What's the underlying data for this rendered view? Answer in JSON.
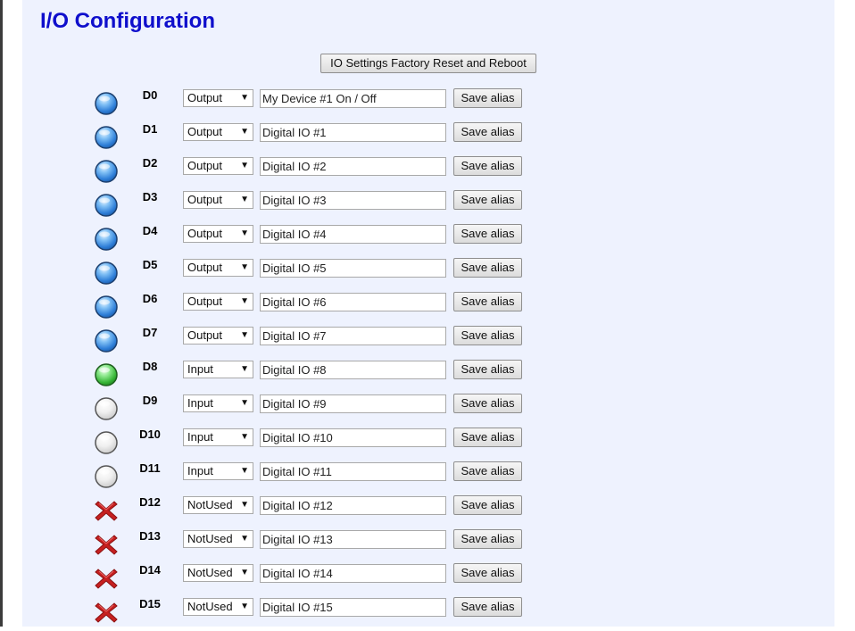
{
  "page": {
    "title": "I/O Configuration"
  },
  "toolbar": {
    "reset_label": "IO Settings Factory Reset and Reboot"
  },
  "colors": {
    "title": "#0f0fcc",
    "panel_bg": "#eef2fe"
  },
  "rows": [
    {
      "pin": "D0",
      "mode": "Output",
      "alias": "My Device #1 On / Off",
      "status_icon": "led-blue-icon",
      "save_label": "Save alias"
    },
    {
      "pin": "D1",
      "mode": "Output",
      "alias": "Digital IO #1",
      "status_icon": "led-blue-icon",
      "save_label": "Save alias"
    },
    {
      "pin": "D2",
      "mode": "Output",
      "alias": "Digital IO #2",
      "status_icon": "led-blue-icon",
      "save_label": "Save alias"
    },
    {
      "pin": "D3",
      "mode": "Output",
      "alias": "Digital IO #3",
      "status_icon": "led-blue-icon",
      "save_label": "Save alias"
    },
    {
      "pin": "D4",
      "mode": "Output",
      "alias": "Digital IO #4",
      "status_icon": "led-blue-icon",
      "save_label": "Save alias"
    },
    {
      "pin": "D5",
      "mode": "Output",
      "alias": "Digital IO #5",
      "status_icon": "led-blue-icon",
      "save_label": "Save alias"
    },
    {
      "pin": "D6",
      "mode": "Output",
      "alias": "Digital IO #6",
      "status_icon": "led-blue-icon",
      "save_label": "Save alias"
    },
    {
      "pin": "D7",
      "mode": "Output",
      "alias": "Digital IO #7",
      "status_icon": "led-blue-icon",
      "save_label": "Save alias"
    },
    {
      "pin": "D8",
      "mode": "Input",
      "alias": "Digital IO #8",
      "status_icon": "led-green-icon",
      "save_label": "Save alias"
    },
    {
      "pin": "D9",
      "mode": "Input",
      "alias": "Digital IO #9",
      "status_icon": "led-off-icon",
      "save_label": "Save alias"
    },
    {
      "pin": "D10",
      "mode": "Input",
      "alias": "Digital IO #10",
      "status_icon": "led-off-icon",
      "save_label": "Save alias"
    },
    {
      "pin": "D11",
      "mode": "Input",
      "alias": "Digital IO #11",
      "status_icon": "led-off-icon",
      "save_label": "Save alias"
    },
    {
      "pin": "D12",
      "mode": "NotUsed",
      "alias": "Digital IO #12",
      "status_icon": "not-used-x-icon",
      "save_label": "Save alias"
    },
    {
      "pin": "D13",
      "mode": "NotUsed",
      "alias": "Digital IO #13",
      "status_icon": "not-used-x-icon",
      "save_label": "Save alias"
    },
    {
      "pin": "D14",
      "mode": "NotUsed",
      "alias": "Digital IO #14",
      "status_icon": "not-used-x-icon",
      "save_label": "Save alias"
    },
    {
      "pin": "D15",
      "mode": "NotUsed",
      "alias": "Digital IO #15",
      "status_icon": "not-used-x-icon",
      "save_label": "Save alias"
    }
  ]
}
